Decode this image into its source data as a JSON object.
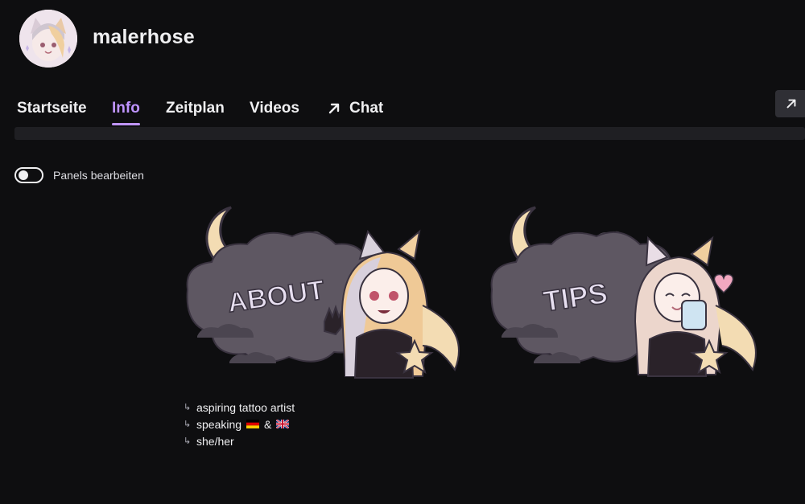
{
  "channel": {
    "name": "malerhose"
  },
  "nav": {
    "tabs": [
      {
        "label": "Startseite"
      },
      {
        "label": "Info"
      },
      {
        "label": "Zeitplan"
      },
      {
        "label": "Videos"
      },
      {
        "label": "Chat"
      }
    ],
    "active_tab": "Info"
  },
  "edit_panels": {
    "label": "Panels bearbeiten",
    "enabled": false
  },
  "panels": [
    {
      "title": "ABOUT"
    },
    {
      "title": "TIPS"
    }
  ],
  "about": {
    "lines": [
      {
        "text": "aspiring tattoo artist"
      },
      {
        "text": "speaking",
        "joiner": "&"
      },
      {
        "text": "she/her"
      }
    ]
  },
  "colors": {
    "accent": "#bf94ff",
    "background": "#0e0e10",
    "cloud": "#5e5762",
    "moon": "#f3dcb3"
  }
}
